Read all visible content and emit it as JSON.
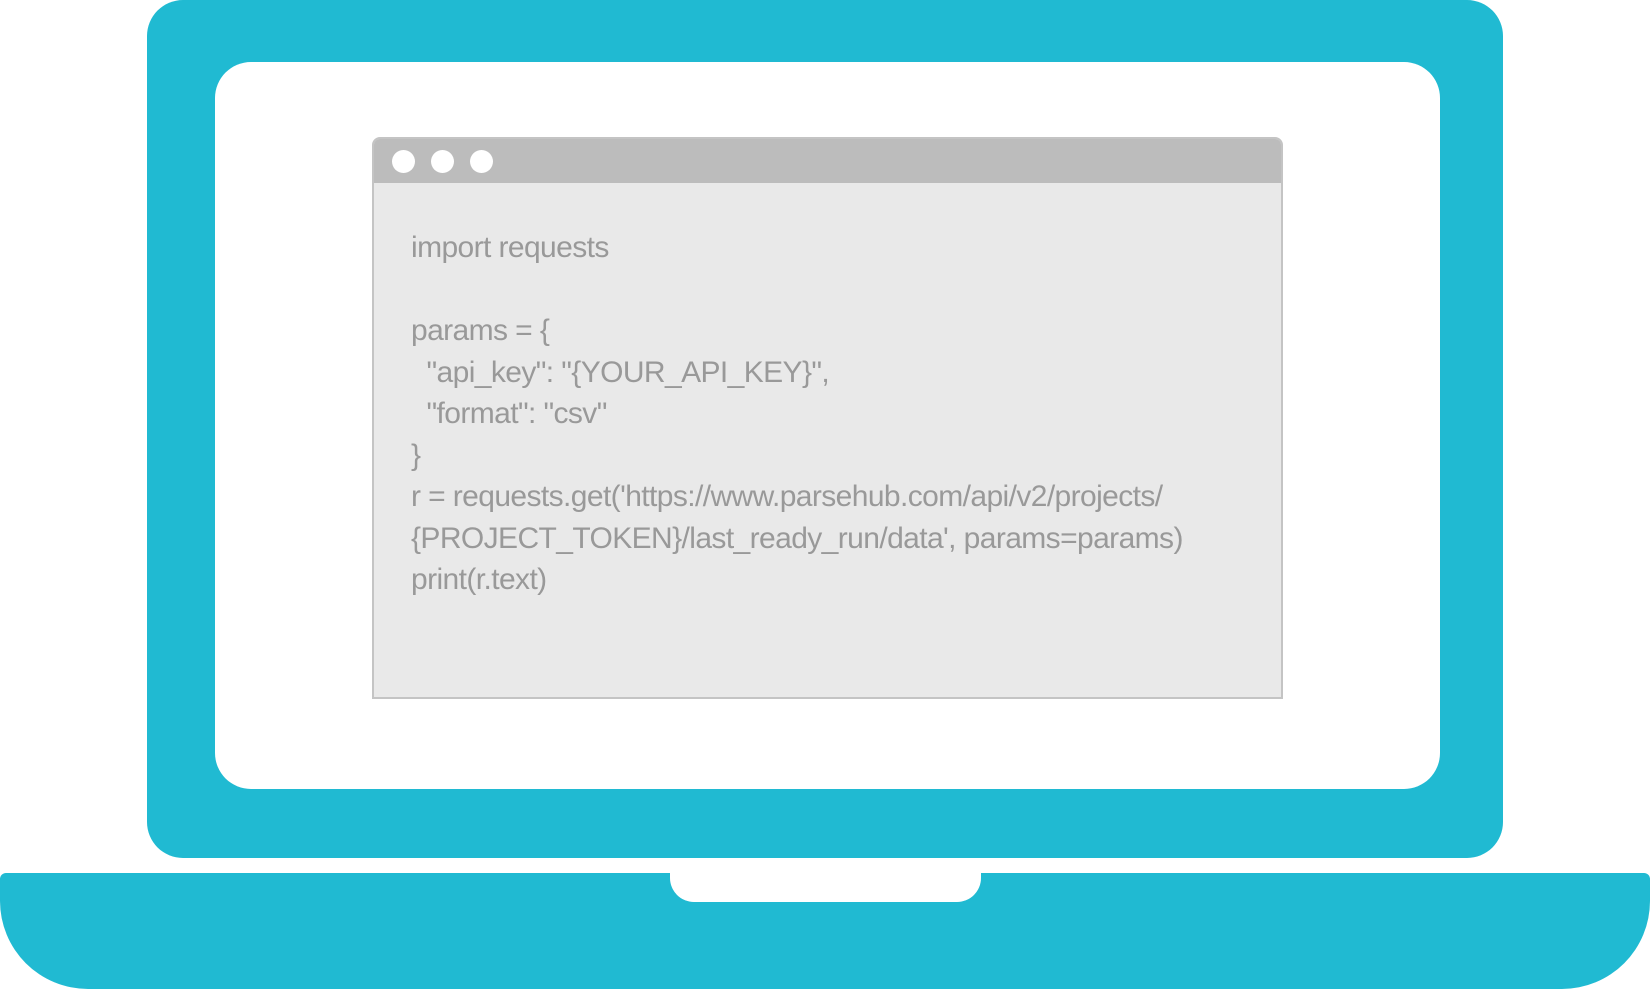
{
  "colors": {
    "laptop_body": "#20bad2",
    "screen": "#ffffff",
    "window_bar": "#bcbcbc",
    "window_bg": "#e9e9e9",
    "code_text": "#999999"
  },
  "window": {
    "controls": [
      "window-dot-icon",
      "window-dot-icon",
      "window-dot-icon"
    ]
  },
  "code": {
    "lines": [
      "import requests",
      "",
      "params = {",
      "  \"api_key\": \"{YOUR_API_KEY}\",",
      "  \"format\": \"csv\"",
      "}",
      "r = requests.get('https://www.parsehub.com/api/v2/projects/",
      "{PROJECT_TOKEN}/last_ready_run/data', params=params)",
      "print(r.text)"
    ]
  }
}
